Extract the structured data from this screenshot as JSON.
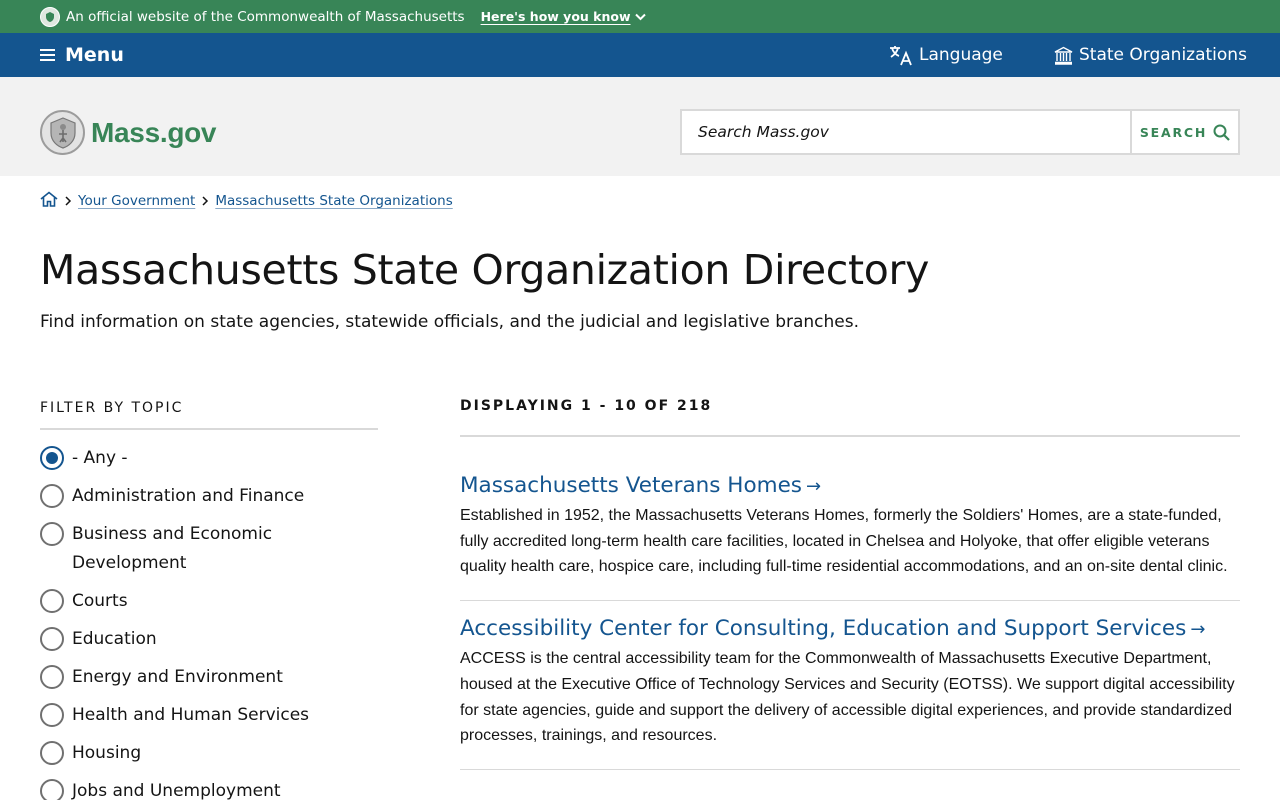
{
  "official_banner": {
    "text": "An official website of the Commonwealth of Massachusetts",
    "how_label": "Here's how you know"
  },
  "menubar": {
    "menu_label": "Menu",
    "language_label": "Language",
    "state_orgs_label": "State Organizations"
  },
  "header": {
    "logo_text": "Mass.gov",
    "search_placeholder": "Search Mass.gov",
    "search_button": "SEARCH"
  },
  "breadcrumb": {
    "items": [
      "Your Government",
      "Massachusetts State Organizations"
    ]
  },
  "page": {
    "title": "Massachusetts State Organization Directory",
    "subtitle": "Find information on state agencies, statewide officials, and the judicial and legislative branches."
  },
  "filter": {
    "heading": "FILTER BY TOPIC",
    "selected_index": 0,
    "options": [
      "- Any -",
      "Administration and Finance",
      "Business and Economic Development",
      "Courts",
      "Education",
      "Energy and Environment",
      "Health and Human Services",
      "Housing",
      "Jobs and Unemployment"
    ]
  },
  "results": {
    "count_text": "DISPLAYING 1 - 10 OF 218",
    "items": [
      {
        "title": "Massachusetts Veterans Homes",
        "description": "Established in 1952, the Massachusetts Veterans Homes, formerly the Soldiers' Homes, are a state-funded, fully accredited long-term health care facilities, located in Chelsea and Holyoke, that offer eligible veterans quality health care, hospice care, including full-time residential accommodations, and an on-site dental clinic."
      },
      {
        "title": "Accessibility Center for Consulting, Education and Support Services",
        "description": "ACCESS is the central accessibility team for the Commonwealth of Massachusetts Executive Department, housed at the Executive Office of Technology Services and Security (EOTSS).  We support digital accessibility for state agencies, guide and support the delivery of accessible digital experiences, and provide standardized processes, trainings, and resources."
      }
    ]
  },
  "colors": {
    "banner_green": "#388557",
    "menubar_blue": "#14558f",
    "header_gray": "#f2f2f2",
    "link_blue": "#14558f"
  }
}
